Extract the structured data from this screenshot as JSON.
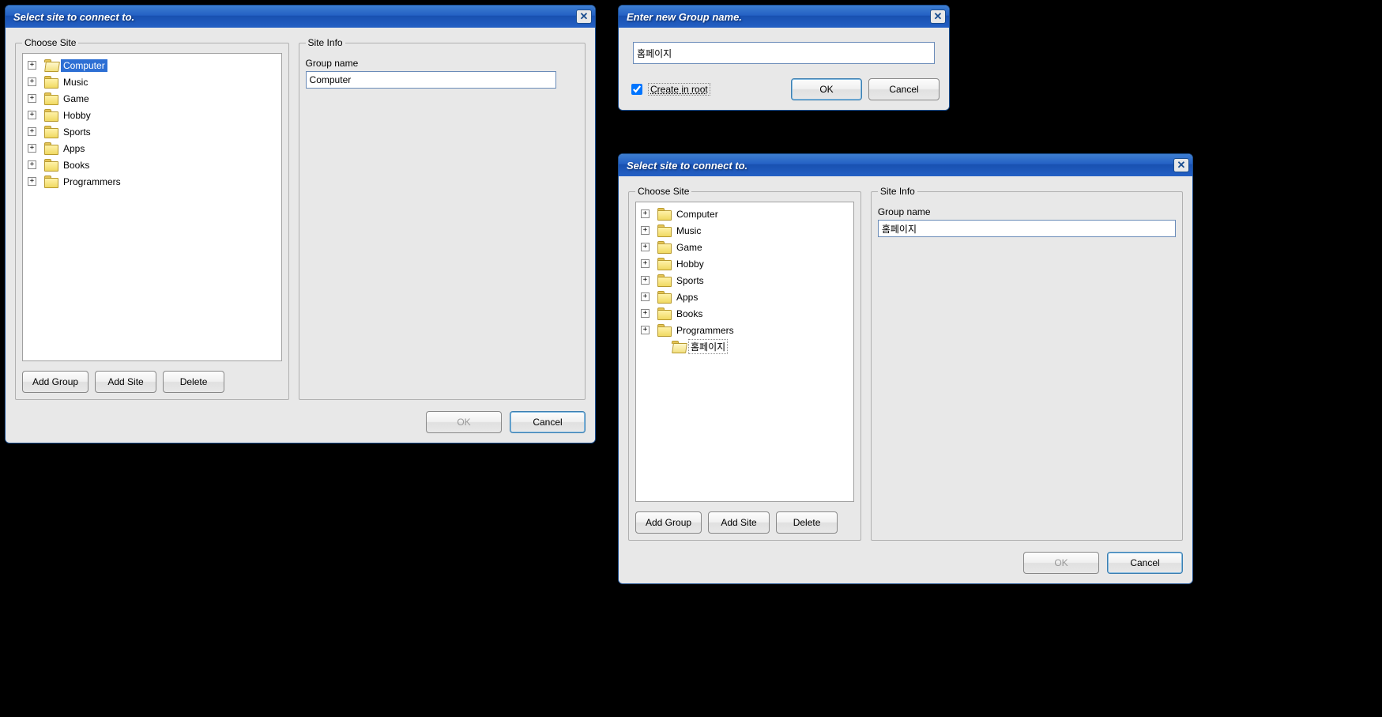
{
  "dialog1": {
    "title": "Select site to connect to.",
    "choose_legend": "Choose Site",
    "siteinfo_legend": "Site Info",
    "groupname_label": "Group name",
    "groupname_value": "Computer",
    "tree": [
      {
        "label": "Computer",
        "selected": true,
        "open": true
      },
      {
        "label": "Music"
      },
      {
        "label": "Game"
      },
      {
        "label": "Hobby"
      },
      {
        "label": "Sports"
      },
      {
        "label": "Apps"
      },
      {
        "label": "Books"
      },
      {
        "label": "Programmers"
      }
    ],
    "add_group": "Add Group",
    "add_site": "Add Site",
    "delete": "Delete",
    "ok": "OK",
    "cancel": "Cancel"
  },
  "dialog2": {
    "title": "Enter new Group name.",
    "input_value": "홈페이지",
    "checkbox_label": "Create in root",
    "ok": "OK",
    "cancel": "Cancel"
  },
  "dialog3": {
    "title": "Select site to connect to.",
    "choose_legend": "Choose Site",
    "siteinfo_legend": "Site Info",
    "groupname_label": "Group name",
    "groupname_value": "홈페이지",
    "tree": [
      {
        "label": "Computer"
      },
      {
        "label": "Music"
      },
      {
        "label": "Game"
      },
      {
        "label": "Hobby"
      },
      {
        "label": "Sports"
      },
      {
        "label": "Apps"
      },
      {
        "label": "Books"
      },
      {
        "label": "Programmers"
      },
      {
        "label": "홈페이지",
        "boxed": true,
        "open": true,
        "no_expander": true
      }
    ],
    "add_group": "Add Group",
    "add_site": "Add Site",
    "delete": "Delete",
    "ok": "OK",
    "cancel": "Cancel"
  }
}
